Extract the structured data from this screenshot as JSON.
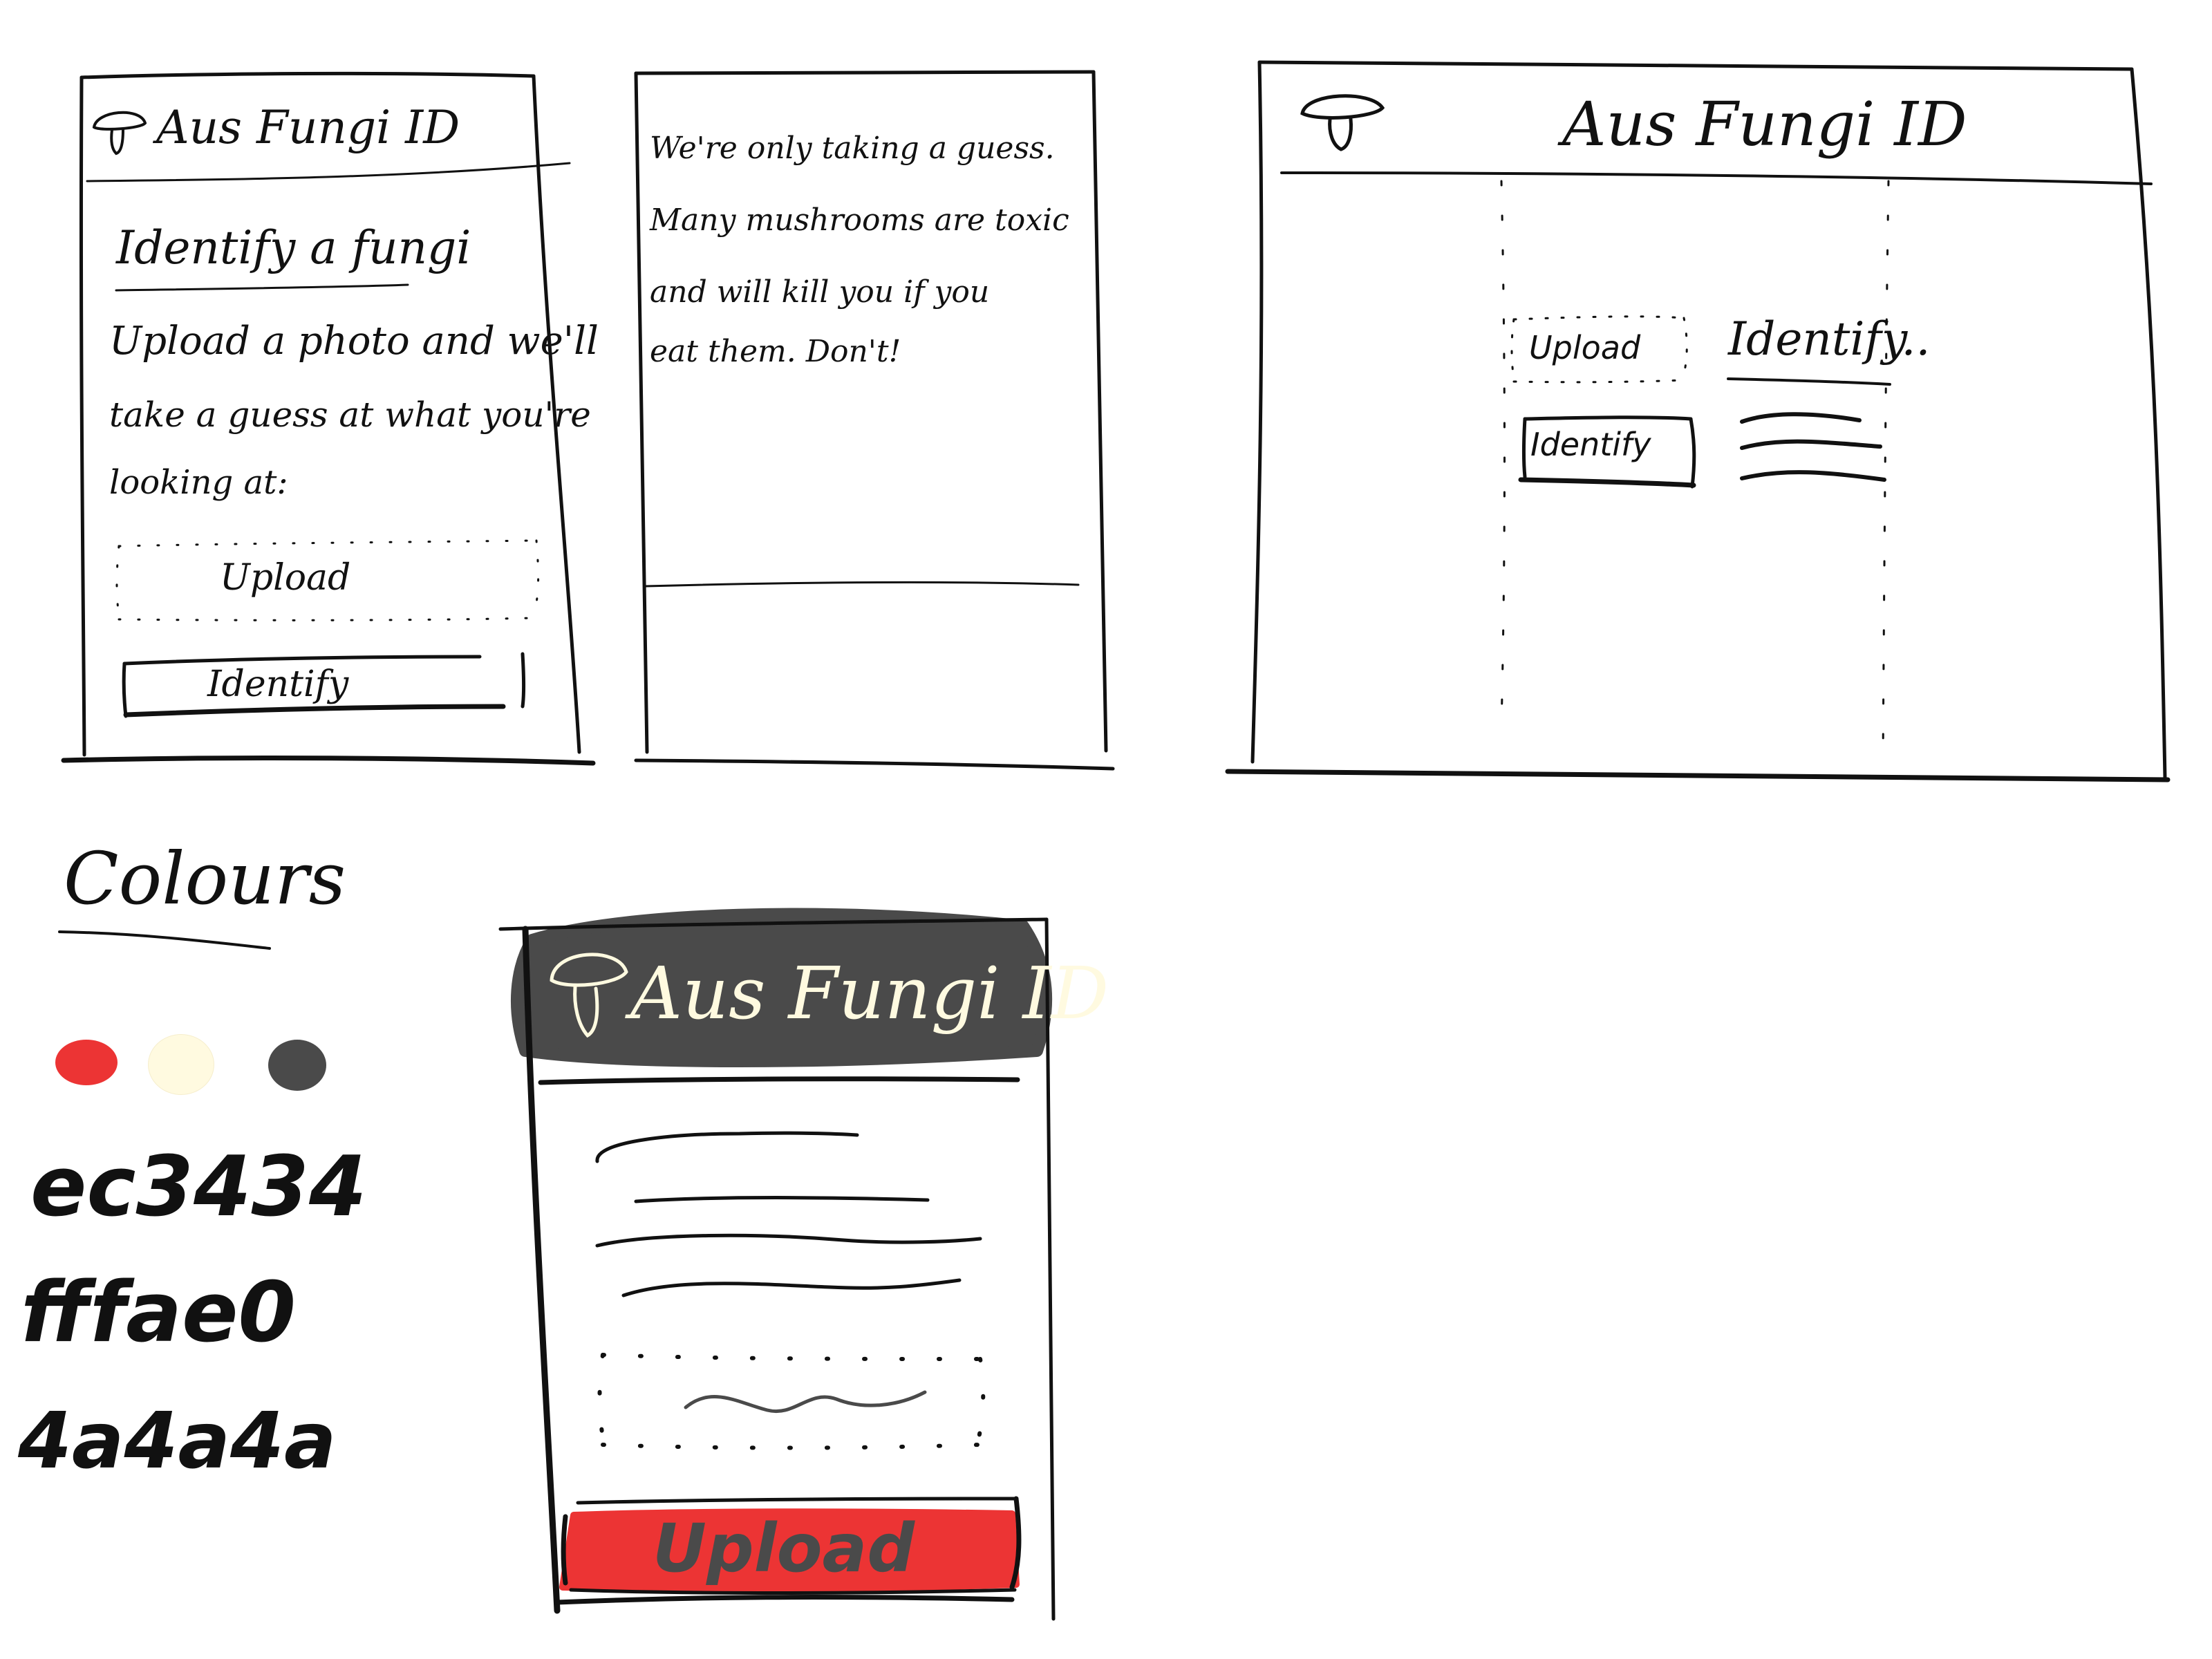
{
  "app": {
    "name": "Aus Fungi ID",
    "name_alt": "Aus Fungi ID",
    "name_color_mockup": "Aus Fungi ID"
  },
  "mobile_screen": {
    "heading": "Identify a fungi",
    "intro_line1": "Upload a photo and we'll",
    "intro_line2": "take a guess at what you're",
    "intro_line3": "looking at:",
    "upload_label": "Upload",
    "identify_label": "Identify"
  },
  "disclaimer_screen": {
    "line1": "We're only taking a guess.",
    "line2": "Many mushrooms are toxic",
    "line3": "and will kill you if you",
    "line4": "eat them. Don't!"
  },
  "desktop_screen": {
    "upload_label": "Upload",
    "identify_label": "Identify",
    "result_heading": "Identify.."
  },
  "colours": {
    "title": "Colours",
    "red": "ec3434",
    "cream": "fffae0",
    "grey": "4a4a4a",
    "red_hex": "#ec3434",
    "cream_hex": "#fffae0",
    "grey_hex": "#4a4a4a"
  },
  "color_mockup": {
    "upload_label": "Upload"
  },
  "icons": [
    "mushroom-icon",
    "color-swatch-red",
    "color-swatch-cream",
    "color-swatch-grey"
  ]
}
